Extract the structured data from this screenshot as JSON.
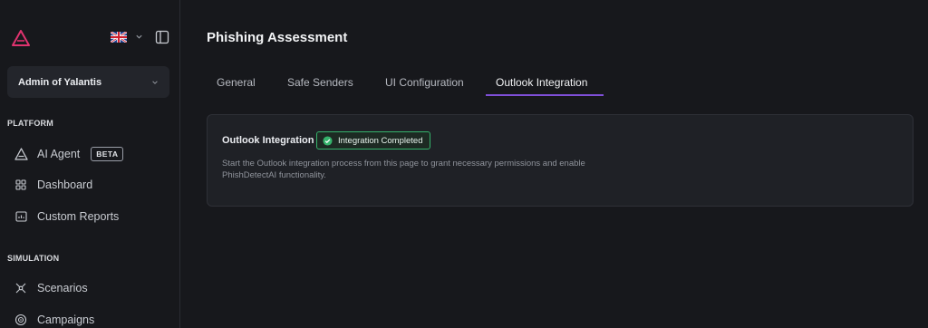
{
  "sidebar": {
    "org_selector": {
      "label": "Admin of Yalantis"
    },
    "platform_section": "PLATFORM",
    "simulation_section": "SIMULATION",
    "items": [
      {
        "label": "AI Agent",
        "icon": "ai-agent-icon",
        "badge": "BETA"
      },
      {
        "label": "Dashboard",
        "icon": "dashboard-icon"
      },
      {
        "label": "Custom Reports",
        "icon": "reports-icon"
      },
      {
        "label": "Scenarios",
        "icon": "scenarios-icon"
      },
      {
        "label": "Campaigns",
        "icon": "campaigns-icon"
      }
    ],
    "language_flag": "uk-flag-icon"
  },
  "main": {
    "title": "Phishing Assessment",
    "tabs": [
      {
        "label": "General",
        "active": false
      },
      {
        "label": "Safe Senders",
        "active": false
      },
      {
        "label": "UI Configuration",
        "active": false
      },
      {
        "label": "Outlook Integration",
        "active": true
      }
    ],
    "card": {
      "title": "Outlook Integration",
      "status": "Integration Completed",
      "description": "Start the Outlook integration process from this page to grant necessary permissions and enable PhishDetectAI functionality."
    }
  },
  "colors": {
    "background": "#17181c",
    "accent": "#7f4fd8",
    "logo": "#e0336f",
    "success": "#35b36b"
  }
}
